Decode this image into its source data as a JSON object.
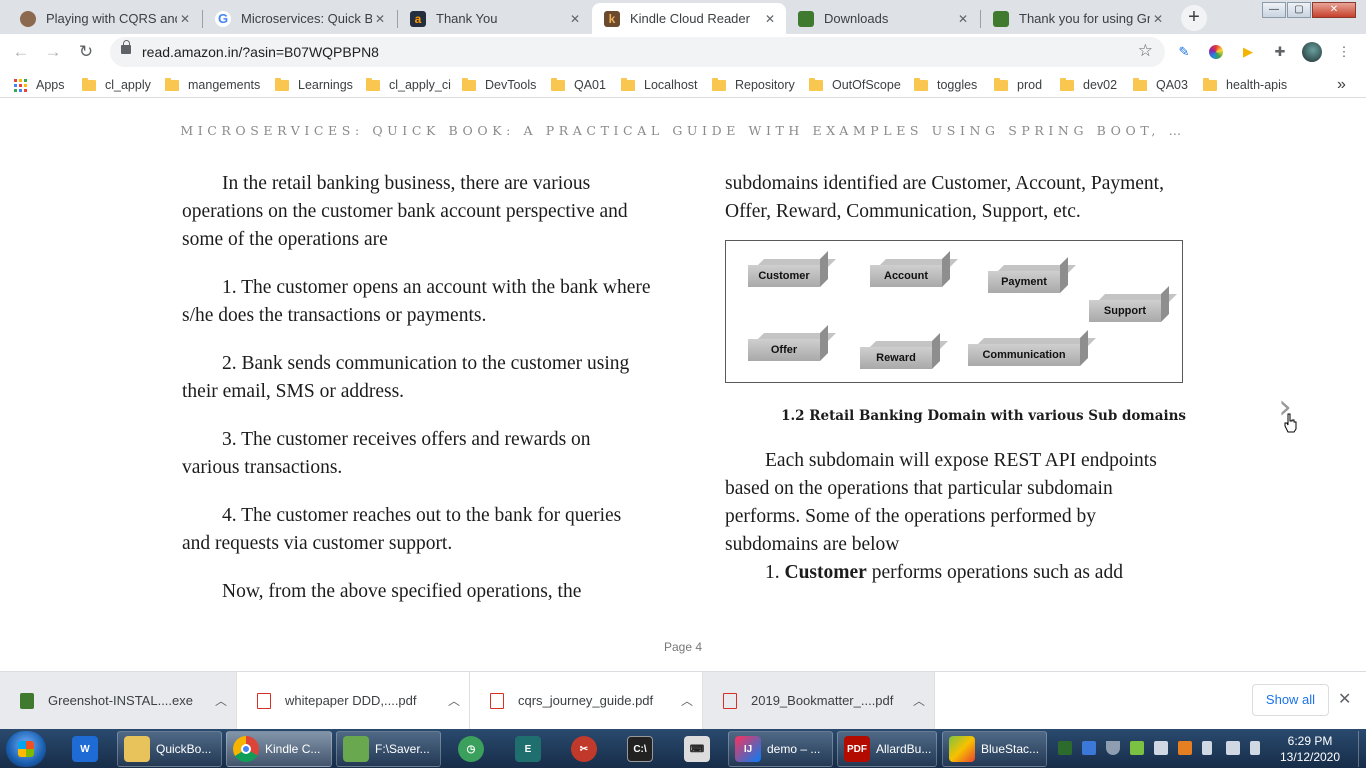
{
  "browser": {
    "tabs": [
      {
        "title": "Playing with CQRS and E",
        "favicon": "avatar-icon",
        "color": "#8b6a4f",
        "active": false
      },
      {
        "title": "Microservices: Quick Boo",
        "favicon": "google-icon",
        "color": "#4285f4",
        "active": false
      },
      {
        "title": "Thank You",
        "favicon": "amazon-icon",
        "color": "#232f3e",
        "active": false
      },
      {
        "title": "Kindle Cloud Reader",
        "favicon": "kindle-icon",
        "color": "#6b4a2e",
        "active": true
      },
      {
        "title": "Downloads",
        "favicon": "greenshot-icon",
        "color": "#3f7a2e",
        "active": false
      },
      {
        "title": "Thank you for using Gree",
        "favicon": "greenshot-icon",
        "color": "#3f7a2e",
        "active": false
      }
    ],
    "new_tab_symbol": "+",
    "url": "read.amazon.in/?asin=B07WQPBPN8"
  },
  "bookmarks": {
    "apps_label": "Apps",
    "items": [
      "cl_apply",
      "mangements",
      "Learnings",
      "cl_apply_ci",
      "DevTools",
      "QA01",
      "Localhost",
      "Repository",
      "OutOfScope",
      "toggles",
      "prod",
      "dev02",
      "QA03",
      "health-apis"
    ],
    "overflow_symbol": "»"
  },
  "reader": {
    "book_title": "MICROSERVICES: QUICK BOOK: A PRACTICAL GUIDE WITH EXAMPLES USING SPRING BOOT, …",
    "left_column": [
      "In the retail banking business, there are various operations on the customer bank account perspective and some of the operations are",
      "1. The customer opens an account with the bank where s/he does the transactions or payments.",
      "2. Bank sends communication to the customer using their email, SMS or address.",
      "3. The customer receives offers and rewards on various transactions.",
      "4. The customer reaches out to the bank for queries and requests via customer support.",
      "Now, from the above specified operations, the"
    ],
    "right_intro": "subdomains identified are Customer, Account, Payment, Offer, Reward, Communication, Support, etc.",
    "figure_boxes": [
      "Customer",
      "Account",
      "Payment",
      "Support",
      "Offer",
      "Reward",
      "Communication"
    ],
    "figure_caption": "1.2 Retail Banking Domain with various Sub domains",
    "right_para": "Each subdomain will expose REST API endpoints based on the operations that particular subdomain performs. Some of the operations performed by subdomains are below",
    "list_item_prefix": "1. ",
    "list_item_bold": "Customer",
    "list_item_rest": " performs operations such as add",
    "page_label": "Page 4",
    "next_symbol": "›"
  },
  "downloads": {
    "items": [
      {
        "name": "Greenshot-INSTAL....exe",
        "icon": "installer-icon"
      },
      {
        "name": "whitepaper DDD,....pdf",
        "icon": "pdf-icon"
      },
      {
        "name": "cqrs_journey_guide.pdf",
        "icon": "pdf-icon"
      },
      {
        "name": "2019_Bookmatter_....pdf",
        "icon": "pdf-icon"
      }
    ],
    "show_all_label": "Show all",
    "close_symbol": "✕"
  },
  "taskbar": {
    "items": [
      {
        "label": "",
        "icon": "pinned-app-icon",
        "color": "#1e6bd6"
      },
      {
        "label": "QuickBo...",
        "icon": "folder-icon",
        "color": "#e8c25a"
      },
      {
        "label": "Kindle C...",
        "icon": "chrome-icon",
        "color": "#db4437"
      },
      {
        "label": "F:\\Saver...",
        "icon": "notepad-icon",
        "color": "#6aa84f"
      },
      {
        "label": "",
        "icon": "clock-app-icon",
        "color": "#3aa05b"
      },
      {
        "label": "",
        "icon": "editor-icon",
        "color": "#1f6f6f"
      },
      {
        "label": "",
        "icon": "snipping-icon",
        "color": "#c0392b"
      },
      {
        "label": "",
        "icon": "terminal-icon",
        "color": "#222222"
      },
      {
        "label": "",
        "icon": "keyboard-icon",
        "color": "#dddddd"
      },
      {
        "label": "demo – ...",
        "icon": "intellij-icon",
        "color": "#fe315d"
      },
      {
        "label": "AllardBu...",
        "icon": "pdf-reader-icon",
        "color": "#b30b00"
      },
      {
        "label": "BlueStac...",
        "icon": "bluestacks-icon",
        "color": "#7cc242"
      }
    ],
    "clock_time": "6:29 PM",
    "clock_date": "13/12/2020"
  }
}
